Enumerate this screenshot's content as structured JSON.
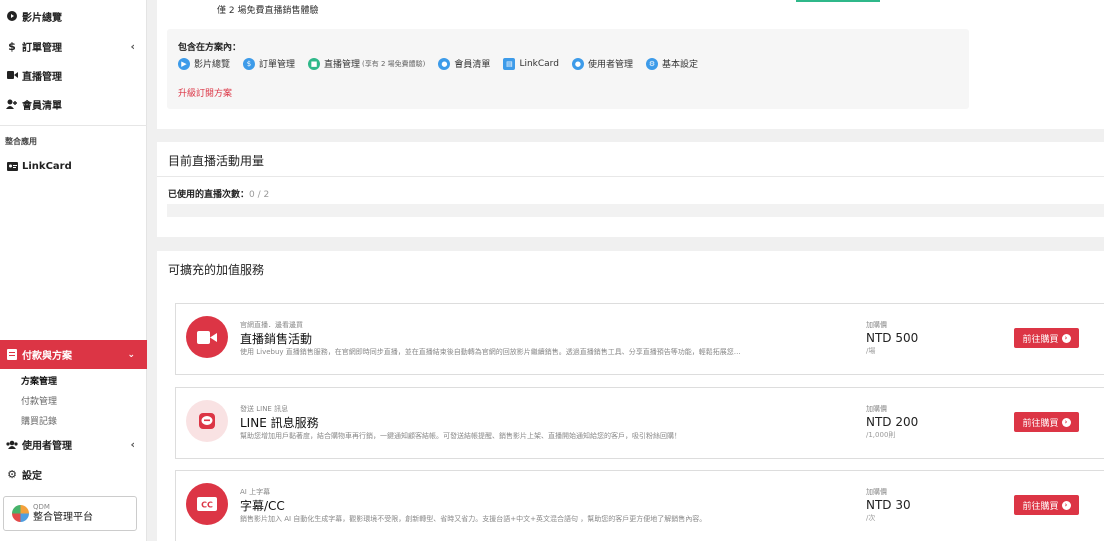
{
  "sidebar": {
    "items": [
      {
        "label": "影片總覽",
        "icon": "play-circle-icon"
      },
      {
        "label": "訂單管理",
        "icon": "dollar-icon"
      },
      {
        "label": "直播管理",
        "icon": "video-camera-icon"
      },
      {
        "label": "會員清單",
        "icon": "user-plus-icon"
      }
    ],
    "section_integrations": "整合應用",
    "linkcard": "LinkCard",
    "payment": "付款與方案",
    "sub_items": [
      "方案管理",
      "付款管理",
      "購買記錄"
    ],
    "user_mgmt": "使用者管理",
    "settings": "設定",
    "workspace": {
      "small": "QDM",
      "name": "整合管理平台"
    }
  },
  "plan": {
    "top_note": "僅 2 場免費直播銷售體驗",
    "includes_title": "包含在方案內：",
    "features": [
      {
        "label": "影片總覽",
        "icon": "play-icon",
        "note": ""
      },
      {
        "label": "訂單管理",
        "icon": "dollar-icon",
        "note": ""
      },
      {
        "label": "直播管理",
        "icon": "video-icon",
        "note": "(享有 2 場免費體驗)"
      },
      {
        "label": "會員清單",
        "icon": "users-icon",
        "note": ""
      },
      {
        "label": "LinkCard",
        "icon": "card-icon",
        "note": ""
      },
      {
        "label": "使用者管理",
        "icon": "user-group-icon",
        "note": ""
      },
      {
        "label": "基本設定",
        "icon": "gear-icon",
        "note": ""
      }
    ],
    "upgrade_link": "升級訂閱方案"
  },
  "usage": {
    "title": "目前直播活動用量",
    "label": "已使用的直播次數：",
    "value": "0 / 2"
  },
  "services": {
    "title": "可擴充的加值服務",
    "price_label": "加購價",
    "button": "前往購買",
    "items": [
      {
        "tag": "官網直播．邊看邊買",
        "name": "直播銷售活動",
        "desc": "使用 Livebuy 直播銷售服務，在官網即時同步直播，並在直播結束後自動轉為官網的回放影片繼續銷售。透過直播銷售工具、分享直播預告等功能，輕鬆拓展您…",
        "price": "NTD 500",
        "unit": "/場",
        "icon": "video-camera-icon"
      },
      {
        "tag": "發送 LINE 訊息",
        "name": "LINE 訊息服務",
        "desc": "幫助您增加用戶黏著度，結合購物車再行銷，一鍵通知顧客結帳。可發送結帳提醒、銷售影片上架、直播開始通知給您的客戶，吸引粉絲回購！",
        "price": "NTD 200",
        "unit": "/1,000則",
        "icon": "line-icon"
      },
      {
        "tag": "AI 上字幕",
        "name": "字幕/CC",
        "desc": "銷售影片加入 AI 自動化生成字幕，觀影環境不受限，創新轉型、省時又省力。支援台語+中文+英文混合語句 ，幫助您的客戶更方便地了解銷售內容。",
        "price": "NTD 30",
        "unit": "/次",
        "icon": "cc-icon"
      }
    ]
  },
  "colors": {
    "accent": "#dc3545",
    "feature_blue": "#3d9be9",
    "feature_green": "#2fb88a"
  }
}
